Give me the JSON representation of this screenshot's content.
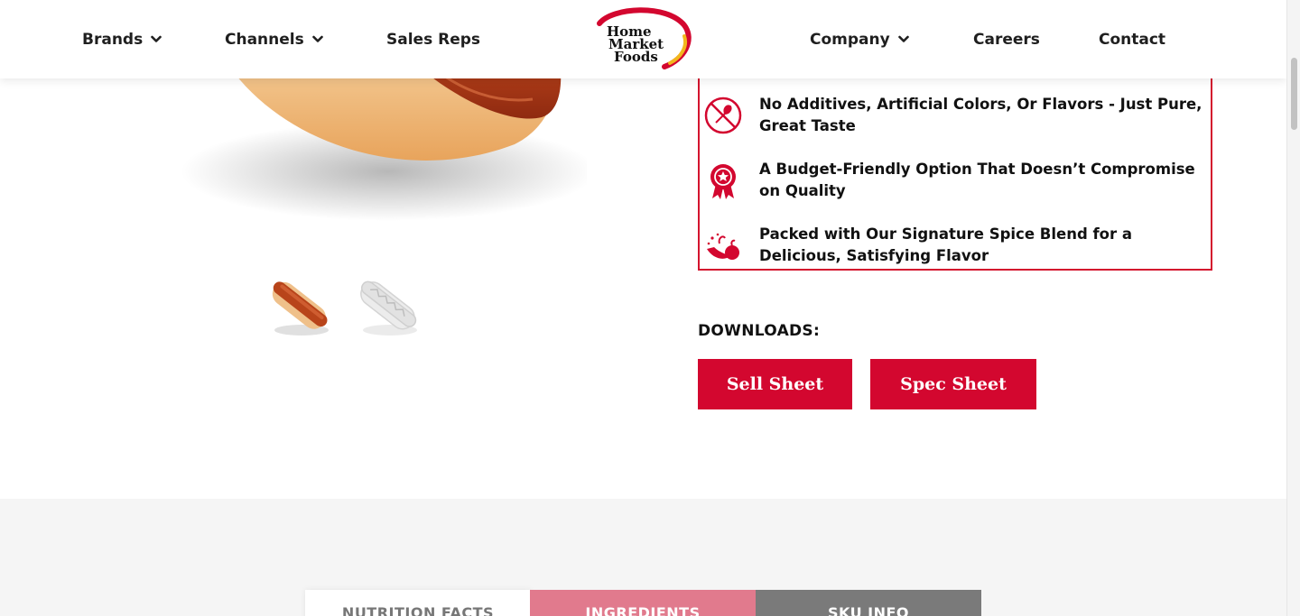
{
  "header": {
    "nav_left": [
      {
        "label": "Brands",
        "has_dropdown": true
      },
      {
        "label": "Channels",
        "has_dropdown": true
      },
      {
        "label": "Sales Reps",
        "has_dropdown": false
      }
    ],
    "logo": {
      "line1": "Home",
      "line2": "Market",
      "line3": "Foods"
    },
    "nav_right": [
      {
        "label": "Company",
        "has_dropdown": true
      },
      {
        "label": "Careers",
        "has_dropdown": false
      },
      {
        "label": "Contact",
        "has_dropdown": false
      }
    ]
  },
  "product": {
    "hero_image": "hot-dog-in-bun",
    "thumbnails": [
      "hot-dog-color-thumbnail",
      "hot-dog-outline-thumbnail"
    ]
  },
  "features": [
    {
      "icon": "no-additives-icon",
      "text": "No Additives, Artificial Colors, Or Flavors - Just Pure, Great Taste"
    },
    {
      "icon": "quality-ribbon-icon",
      "text": "A Budget-Friendly Option That Doesn’t Compromise on Quality"
    },
    {
      "icon": "spice-blend-icon",
      "text": "Packed with Our Signature Spice Blend for a Delicious, Satisfying Flavor"
    }
  ],
  "downloads": {
    "title": "DOWNLOADS:",
    "buttons": [
      {
        "label": "Sell Sheet"
      },
      {
        "label": "Spec Sheet"
      }
    ]
  },
  "tabs": [
    {
      "label": "NUTRITION FACTS",
      "active": false
    },
    {
      "label": "INGREDIENTS",
      "active": true
    },
    {
      "label": "SKU INFO",
      "active": false
    }
  ],
  "colors": {
    "brand_red": "#d3072f",
    "tab_active": "#e17a8d",
    "tab_dark": "#7a7a7a"
  }
}
